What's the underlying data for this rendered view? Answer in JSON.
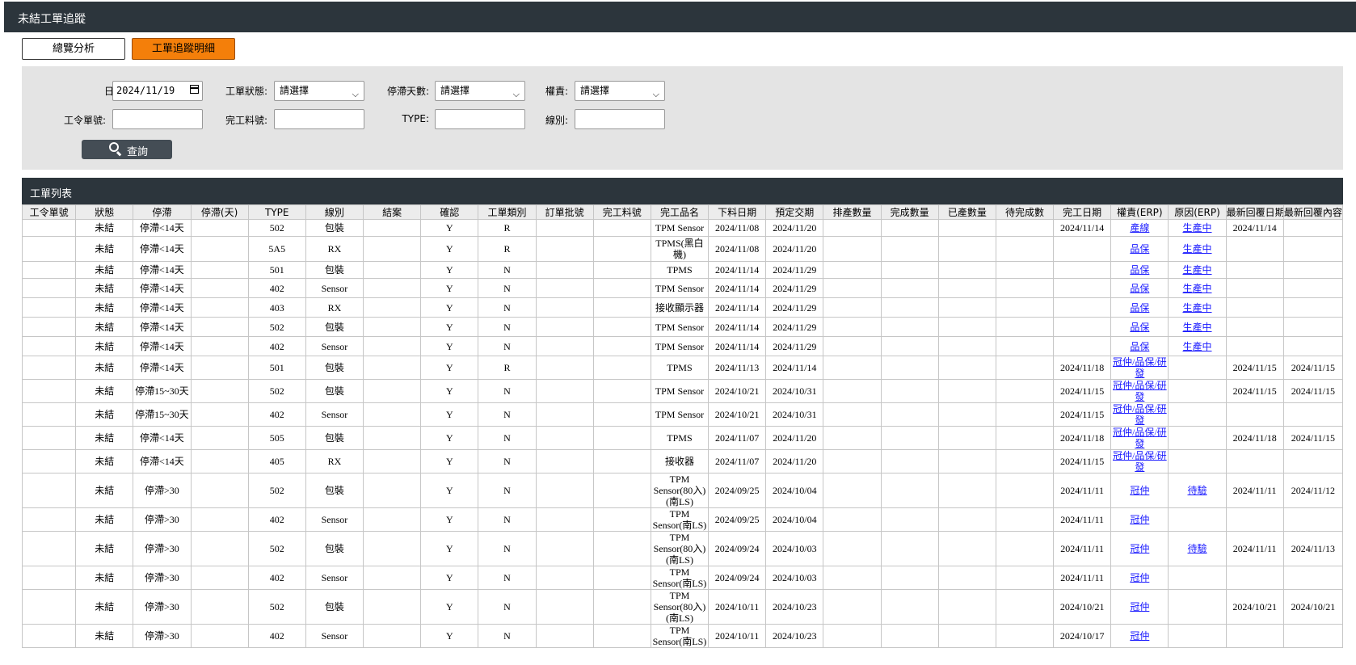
{
  "header": {
    "title": "未結工單追蹤"
  },
  "tabs": {
    "overview": "總覽分析",
    "detail": "工單追蹤明細"
  },
  "filters": {
    "date_label": "日期:",
    "date_value": "2024/11/19",
    "status_label": "工單狀態:",
    "status_value": "請選擇",
    "stagnant_label": "停滯天數:",
    "stagnant_value": "請選擇",
    "owner_label": "權責:",
    "owner_value": "請選擇",
    "order_label": "工令單號:",
    "order_value": "",
    "part_label": "完工料號:",
    "part_value": "",
    "type_label": "TYPE:",
    "type_value": "",
    "line_label": "線別:",
    "line_value": "",
    "search_label": "查詢"
  },
  "list": {
    "title": "工單列表",
    "columns": [
      "工令單號",
      "狀態",
      "停滯",
      "停滯(天)",
      "TYPE",
      "線別",
      "結案",
      "確認",
      "工單類別",
      "訂單批號",
      "完工料號",
      "完工品名",
      "下料日期",
      "預定交期",
      "排產數量",
      "完成數量",
      "已產數量",
      "待完成數",
      "完工日期",
      "權責(ERP)",
      "原因(ERP)",
      "最新回覆日期",
      "最新回覆內容"
    ],
    "rows": [
      {
        "status": "未結",
        "stag": "停滯<14天",
        "type": "502",
        "line": "包裝",
        "confirm": "Y",
        "cat": "R",
        "name": "TPM Sensor",
        "start": "2024/11/08",
        "due": "2024/11/20",
        "done": "2024/11/14",
        "owner": "產線",
        "reason": "生產中",
        "reply_date": "2024/11/14",
        "reply": ""
      },
      {
        "status": "未結",
        "stag": "停滯<14天",
        "type": "5A5",
        "line": "RX",
        "confirm": "Y",
        "cat": "R",
        "name": "TPMS(黑白機)",
        "start": "2024/11/08",
        "due": "2024/11/20",
        "done": "",
        "owner": "品保",
        "reason": "生產中",
        "reply_date": "",
        "reply": ""
      },
      {
        "status": "未結",
        "stag": "停滯<14天",
        "type": "501",
        "line": "包裝",
        "confirm": "Y",
        "cat": "N",
        "name": "TPMS",
        "start": "2024/11/14",
        "due": "2024/11/29",
        "done": "",
        "owner": "品保",
        "reason": "生產中",
        "reply_date": "",
        "reply": ""
      },
      {
        "status": "未結",
        "stag": "停滯<14天",
        "type": "402",
        "line": "Sensor",
        "confirm": "Y",
        "cat": "N",
        "name": "TPM Sensor",
        "start": "2024/11/14",
        "due": "2024/11/29",
        "done": "",
        "owner": "品保",
        "reason": "生產中",
        "reply_date": "",
        "reply": ""
      },
      {
        "status": "未結",
        "stag": "停滯<14天",
        "type": "403",
        "line": "RX",
        "confirm": "Y",
        "cat": "N",
        "name": "接收顯示器",
        "start": "2024/11/14",
        "due": "2024/11/29",
        "done": "",
        "owner": "品保",
        "reason": "生產中",
        "reply_date": "",
        "reply": ""
      },
      {
        "status": "未結",
        "stag": "停滯<14天",
        "type": "502",
        "line": "包裝",
        "confirm": "Y",
        "cat": "N",
        "name": "TPM Sensor",
        "start": "2024/11/14",
        "due": "2024/11/29",
        "done": "",
        "owner": "品保",
        "reason": "生產中",
        "reply_date": "",
        "reply": ""
      },
      {
        "status": "未結",
        "stag": "停滯<14天",
        "type": "402",
        "line": "Sensor",
        "confirm": "Y",
        "cat": "N",
        "name": "TPM Sensor",
        "start": "2024/11/14",
        "due": "2024/11/29",
        "done": "",
        "owner": "品保",
        "reason": "生產中",
        "reply_date": "",
        "reply": ""
      },
      {
        "status": "未結",
        "stag": "停滯<14天",
        "type": "501",
        "line": "包裝",
        "confirm": "Y",
        "cat": "R",
        "name": "TPMS",
        "start": "2024/11/13",
        "due": "2024/11/14",
        "done": "2024/11/18",
        "owner": "冠仲/品保/研發",
        "reason": "",
        "reply_date": "2024/11/15",
        "reply": "2024/11/15"
      },
      {
        "status": "未結",
        "stag": "停滯15~30天",
        "type": "502",
        "line": "包裝",
        "confirm": "Y",
        "cat": "N",
        "name": "TPM Sensor",
        "start": "2024/10/21",
        "due": "2024/10/31",
        "done": "2024/11/15",
        "owner": "冠仲/品保/研發",
        "reason": "",
        "reply_date": "2024/11/15",
        "reply": "2024/11/15"
      },
      {
        "status": "未結",
        "stag": "停滯15~30天",
        "type": "402",
        "line": "Sensor",
        "confirm": "Y",
        "cat": "N",
        "name": "TPM Sensor",
        "start": "2024/10/21",
        "due": "2024/10/31",
        "done": "2024/11/15",
        "owner": "冠仲/品保/研發",
        "reason": "",
        "reply_date": "",
        "reply": ""
      },
      {
        "status": "未結",
        "stag": "停滯<14天",
        "type": "505",
        "line": "包裝",
        "confirm": "Y",
        "cat": "N",
        "name": "TPMS",
        "start": "2024/11/07",
        "due": "2024/11/20",
        "done": "2024/11/18",
        "owner": "冠仲/品保/研發",
        "reason": "",
        "reply_date": "2024/11/18",
        "reply": "2024/11/15"
      },
      {
        "status": "未結",
        "stag": "停滯<14天",
        "type": "405",
        "line": "RX",
        "confirm": "Y",
        "cat": "N",
        "name": "接收器",
        "start": "2024/11/07",
        "due": "2024/11/20",
        "done": "2024/11/15",
        "owner": "冠仲/品保/研發",
        "reason": "",
        "reply_date": "",
        "reply": ""
      },
      {
        "status": "未結",
        "stag": "停滯>30",
        "type": "502",
        "line": "包裝",
        "confirm": "Y",
        "cat": "N",
        "name": "TPM Sensor(80入)(南LS)",
        "start": "2024/09/25",
        "due": "2024/10/04",
        "done": "2024/11/11",
        "owner": "冠仲",
        "reason": "待驗",
        "reply_date": "2024/11/11",
        "reply": "2024/11/12"
      },
      {
        "status": "未結",
        "stag": "停滯>30",
        "type": "402",
        "line": "Sensor",
        "confirm": "Y",
        "cat": "N",
        "name": "TPM Sensor(南LS)",
        "start": "2024/09/25",
        "due": "2024/10/04",
        "done": "2024/11/11",
        "owner": "冠仲",
        "reason": "",
        "reply_date": "",
        "reply": ""
      },
      {
        "status": "未結",
        "stag": "停滯>30",
        "type": "502",
        "line": "包裝",
        "confirm": "Y",
        "cat": "N",
        "name": "TPM Sensor(80入)(南LS)",
        "start": "2024/09/24",
        "due": "2024/10/03",
        "done": "2024/11/11",
        "owner": "冠仲",
        "reason": "待驗",
        "reply_date": "2024/11/11",
        "reply": "2024/11/13"
      },
      {
        "status": "未結",
        "stag": "停滯>30",
        "type": "402",
        "line": "Sensor",
        "confirm": "Y",
        "cat": "N",
        "name": "TPM Sensor(南LS)",
        "start": "2024/09/24",
        "due": "2024/10/03",
        "done": "2024/11/11",
        "owner": "冠仲",
        "reason": "",
        "reply_date": "",
        "reply": ""
      },
      {
        "status": "未結",
        "stag": "停滯>30",
        "type": "502",
        "line": "包裝",
        "confirm": "Y",
        "cat": "N",
        "name": "TPM Sensor(80入)(南LS)",
        "start": "2024/10/11",
        "due": "2024/10/23",
        "done": "2024/10/21",
        "owner": "冠仲",
        "reason": "",
        "reply_date": "2024/10/21",
        "reply": "2024/10/21"
      },
      {
        "status": "未結",
        "stag": "停滯>30",
        "type": "402",
        "line": "Sensor",
        "confirm": "Y",
        "cat": "N",
        "name": "TPM Sensor(南LS)",
        "start": "2024/10/11",
        "due": "2024/10/23",
        "done": "2024/10/17",
        "owner": "冠仲",
        "reason": "",
        "reply_date": "",
        "reply": ""
      }
    ]
  }
}
